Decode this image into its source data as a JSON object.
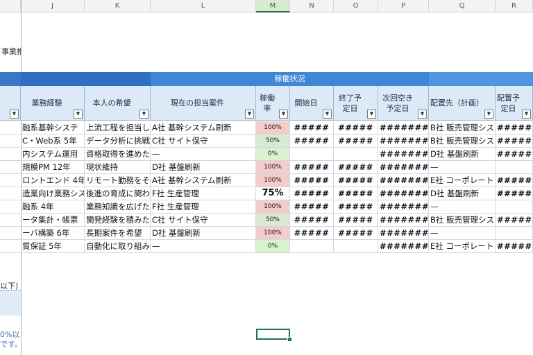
{
  "columns": [
    "J",
    "K",
    "L",
    "M",
    "N",
    "O",
    "P",
    "Q",
    "R"
  ],
  "selected_column": "M",
  "left_fragments": {
    "top": "事業推",
    "note1": "以下)",
    "note2": "0%以",
    "note3": "です。"
  },
  "band": {
    "title": "稼働状況"
  },
  "headers": {
    "J": "業務経験",
    "K": "本人の希望",
    "L": "現在の担当案件",
    "M": "稼働率",
    "N": "開始日",
    "O": "終了予定日",
    "P": "次回空き予定日",
    "Q": "配置先（計画）",
    "R": "配置予定日"
  },
  "rows": [
    {
      "J": "融系基幹システ",
      "K": "上流工程を担当し",
      "L": "A社 基幹システム刷新",
      "M": "100%",
      "N": "#####",
      "O": "#####",
      "P": "#######",
      "Q": "B社 販売管理シス",
      "R": "#####"
    },
    {
      "J": "C・Web系 5年",
      "K": "データ分析に挑戦",
      "L": "C社 サイト保守",
      "M": "50%",
      "N": "#####",
      "O": "#####",
      "P": "#######",
      "Q": "B社 販売管理シス",
      "R": "#####"
    },
    {
      "J": "内システム運用",
      "K": "資格取得を進めた",
      "L": "—",
      "M": "0%",
      "N": "",
      "O": "",
      "P": "#######",
      "Q": "D社 基盤刷新",
      "R": "#####"
    },
    {
      "J": "規模PM 12年",
      "K": "現状維持",
      "L": "D社 基盤刷新",
      "M": "100%",
      "N": "#####",
      "O": "#####",
      "P": "#######",
      "Q": "—",
      "R": ""
    },
    {
      "J": "ロントエンド 4年",
      "K": "リモート勤務をそ",
      "L": "A社 基幹システム刷新",
      "M": "100%",
      "N": "#####",
      "O": "#####",
      "P": "#######",
      "Q": "E社 コーポレート",
      "R": "#####"
    },
    {
      "J": "造業向け業務シス",
      "K": "後進の育成に関わ",
      "L": "F社 生産管理",
      "M": "75%",
      "N": "#####",
      "O": "#####",
      "P": "#######",
      "Q": "D社 基盤刷新",
      "R": "#####"
    },
    {
      "J": "融系 4年",
      "K": "業務知識を広げた",
      "L": "F社 生産管理",
      "M": "100%",
      "N": "#####",
      "O": "#####",
      "P": "#######",
      "Q": "—",
      "R": ""
    },
    {
      "J": "ータ集計・帳票",
      "K": "開発経験を積みた",
      "L": "C社 サイト保守",
      "M": "50%",
      "N": "#####",
      "O": "#####",
      "P": "#######",
      "Q": "B社 販売管理シス",
      "R": "#####"
    },
    {
      "J": "ーバ構築 6年",
      "K": "長期案件を希望",
      "L": "D社 基盤刷新",
      "M": "100%",
      "N": "#####",
      "O": "#####",
      "P": "#######",
      "Q": "—",
      "R": ""
    },
    {
      "J": "質保証 5年",
      "K": "自動化に取り組み",
      "L": "—",
      "M": "0%",
      "N": "",
      "O": "",
      "P": "#######",
      "Q": "E社 コーポレート",
      "R": "#####"
    }
  ],
  "colors": {
    "band_left": "#3b78c4",
    "band_status": "#3f87d6",
    "band_right": "#4f96df",
    "rate_high": "#f4cccc",
    "rate_mid": "#d9ead3",
    "rate_zero": "#d9f2d0",
    "rate_75": "#ffffff",
    "selection": "#217346"
  }
}
